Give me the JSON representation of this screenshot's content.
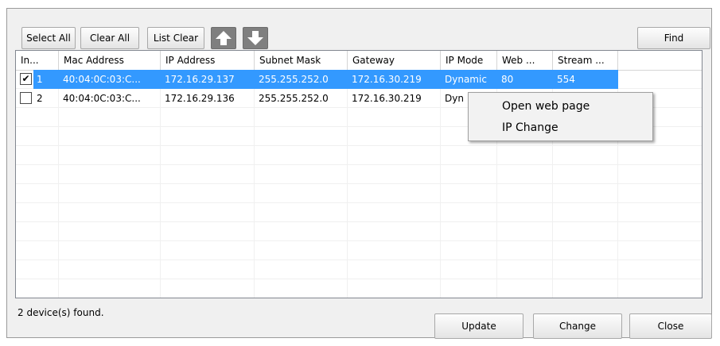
{
  "toolbar": {
    "select_all": "Select All",
    "clear_all": "Clear All",
    "list_clear": "List Clear",
    "find": "Find"
  },
  "columns": [
    "In...",
    "Mac Address",
    "IP Address",
    "Subnet Mask",
    "Gateway",
    "IP Mode",
    "Web ...",
    "Stream ..."
  ],
  "rows": [
    {
      "checked": true,
      "index": "1",
      "mac": "40:04:0C:03:C...",
      "ip": "172.16.29.137",
      "subnet": "255.255.252.0",
      "gateway": "172.16.30.219",
      "ipmode": "Dynamic",
      "web": "80",
      "stream": "554",
      "selected": true
    },
    {
      "checked": false,
      "index": "2",
      "mac": "40:04:0C:03:C...",
      "ip": "172.16.29.136",
      "subnet": "255.255.252.0",
      "gateway": "172.16.30.219",
      "ipmode": "Dyn",
      "web": "",
      "stream": "",
      "selected": false
    }
  ],
  "context_menu": {
    "open_web_page": "Open web page",
    "ip_change": "IP Change"
  },
  "status": "2 device(s) found.",
  "footer": {
    "update": "Update",
    "change": "Change",
    "close": "Close"
  },
  "colors": {
    "selection": "#3399ff",
    "arrow_button": "#7f7f7f"
  },
  "icons": {
    "move_up": "arrow-up-icon",
    "move_down": "arrow-down-icon"
  }
}
